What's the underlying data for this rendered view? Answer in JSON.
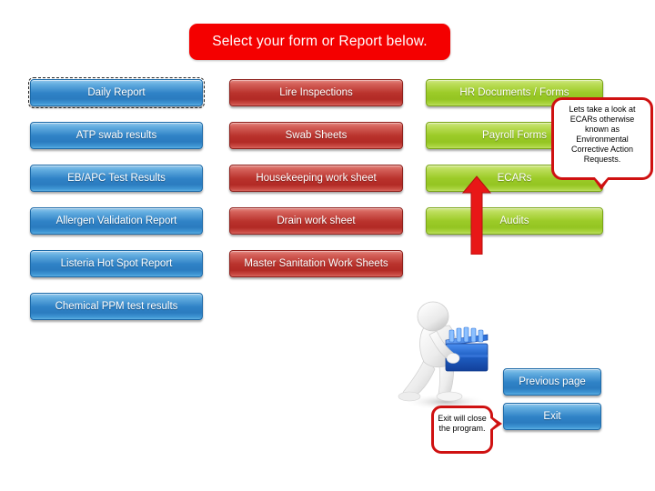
{
  "header": {
    "title": "Select your form or Report below."
  },
  "columns": {
    "reports": {
      "color": "#2f82c6",
      "items": [
        {
          "label": "Daily Report",
          "focused": true
        },
        {
          "label": "ATP swab results",
          "focused": false
        },
        {
          "label": "EB/APC Test Results",
          "focused": false
        },
        {
          "label": "Allergen Validation Report",
          "focused": false
        },
        {
          "label": "Listeria Hot Spot Report",
          "focused": false
        },
        {
          "label": "Chemical PPM test results",
          "focused": false
        }
      ]
    },
    "sheets": {
      "color": "#b9322c",
      "items": [
        {
          "label": "Lire Inspections"
        },
        {
          "label": "Swab Sheets"
        },
        {
          "label": "Housekeeping work sheet"
        },
        {
          "label": "Drain work sheet"
        },
        {
          "label": "Master Sanitation Work Sheets"
        }
      ]
    },
    "documents": {
      "color": "#9ccb28",
      "items": [
        {
          "label": "HR Documents / Forms"
        },
        {
          "label": "Payroll Forms"
        },
        {
          "label": "ECARs"
        },
        {
          "label": "Audits"
        }
      ]
    }
  },
  "callouts": {
    "ecars": {
      "text": "Lets take a look at ECARs otherwise known as Environmental Corrective Action Requests.",
      "border_color": "#cf1111"
    },
    "exit": {
      "text": "Exit will close the program.",
      "border_color": "#cf1111"
    }
  },
  "annotations": {
    "arrow": {
      "name": "red-up-arrow",
      "color": "#e81717",
      "points_to": "ECARs"
    },
    "clipart": {
      "name": "person-carrying-file-crate",
      "body_color": "#f2f2f2",
      "crate_color": "#1f5fc4"
    }
  },
  "footer": {
    "previous_label": "Previous page",
    "exit_label": "Exit"
  }
}
